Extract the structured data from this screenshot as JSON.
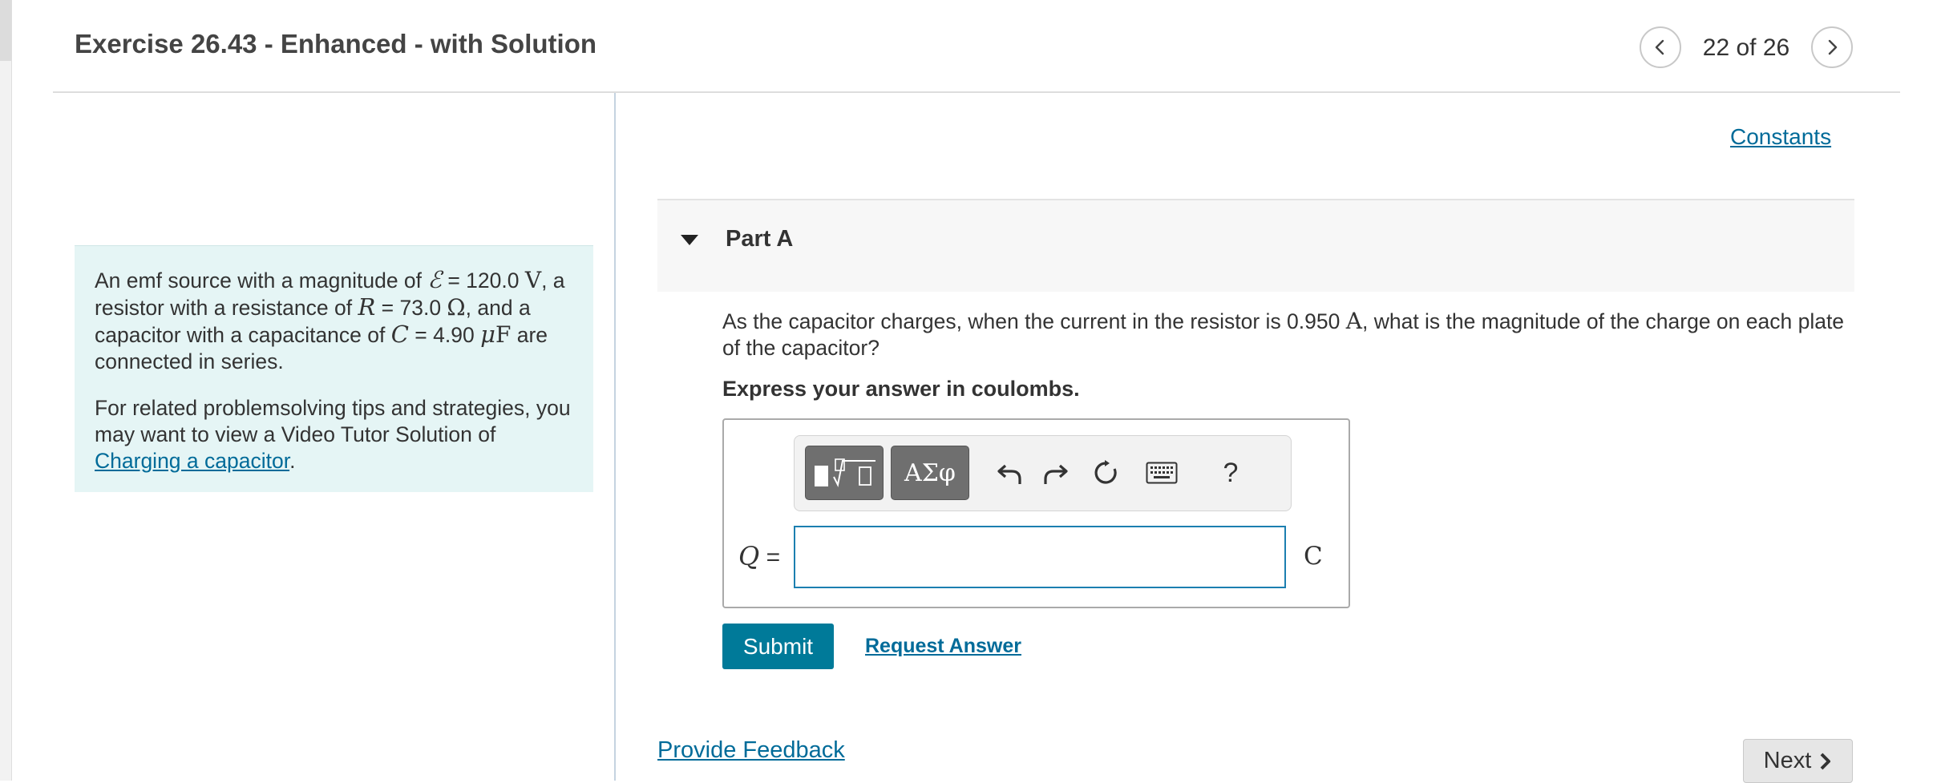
{
  "header": {
    "title": "Exercise 26.43 - Enhanced - with Solution",
    "counter": "22 of 26",
    "prev_icon": "chevron-left-icon",
    "next_icon": "chevron-right-icon"
  },
  "problem": {
    "p1": {
      "t1": "An emf source with a magnitude of ",
      "emf_symbol": "ℰ",
      "t2": " = 120.0 ",
      "emf_unit": "V",
      "t3": ", a resistor with a resistance of ",
      "r_symbol": "R",
      "t4": " = 73.0 ",
      "r_unit": "Ω",
      "t5": ", and a capacitor with a capacitance of ",
      "c_symbol": "C",
      "t6": " = 4.90 ",
      "c_unit_prefix": "μ",
      "c_unit": "F",
      "t7": " are connected in series."
    },
    "p2": {
      "text": "For related problemsolving tips and strategies, you may want to view a Video Tutor Solution of ",
      "link": "Charging a capacitor",
      "end": "."
    }
  },
  "constants_link": "Constants",
  "part": {
    "title": "Part A",
    "toggle_icon": "triangle-down-icon",
    "question_start": "As the capacitor charges, when the current in the resistor is 0.950 ",
    "question_unit": "A",
    "question_end": ", what is the magnitude of the charge on each plate of the capacitor?",
    "instruction": "Express your answer in coulombs."
  },
  "toolbar": {
    "templates_icon": "templates-icon",
    "symbols_label": "ΑΣφ",
    "undo_icon": "undo-icon",
    "redo_icon": "redo-icon",
    "reset_icon": "reset-icon",
    "keyboard_icon": "keyboard-icon",
    "help_label": "?"
  },
  "answer": {
    "variable": "Q",
    "equals": "=",
    "value": "",
    "placeholder": "",
    "unit": "C"
  },
  "actions": {
    "submit": "Submit",
    "request_answer": "Request Answer",
    "provide_feedback": "Provide Feedback",
    "next": "Next"
  },
  "colors": {
    "link": "#006b99",
    "submit_bg": "#007a99",
    "info_bg": "#e5f5f5",
    "input_border": "#1c7fb0"
  }
}
